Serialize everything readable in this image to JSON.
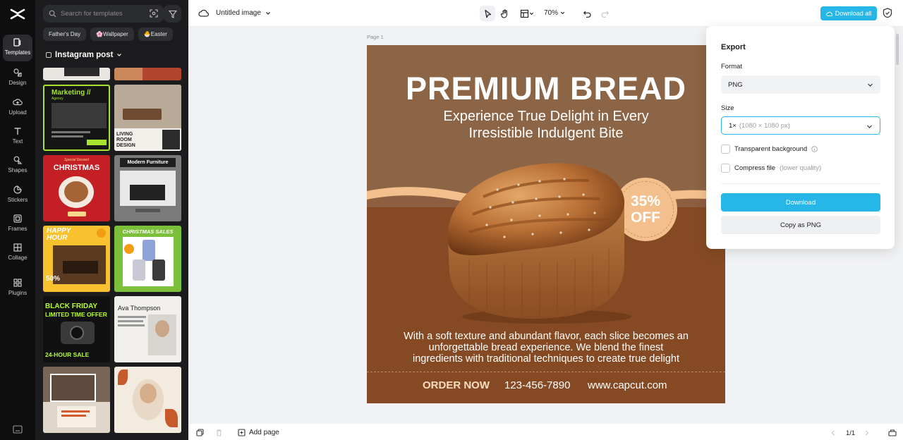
{
  "sidebar": {
    "items": [
      {
        "label": "Templates",
        "icon": "templates-icon"
      },
      {
        "label": "Design",
        "icon": "design-icon"
      },
      {
        "label": "Upload",
        "icon": "upload-icon"
      },
      {
        "label": "Text",
        "icon": "text-icon"
      },
      {
        "label": "Shapes",
        "icon": "shapes-icon"
      },
      {
        "label": "Stickers",
        "icon": "stickers-icon"
      },
      {
        "label": "Frames",
        "icon": "frames-icon"
      },
      {
        "label": "Collage",
        "icon": "collage-icon"
      },
      {
        "label": "Plugins",
        "icon": "plugins-icon"
      }
    ]
  },
  "panel": {
    "search_placeholder": "Search for templates",
    "chips": [
      "Father's Day",
      "🌸Wallpaper",
      "🐣Easter"
    ],
    "category": "Instagram post",
    "templates": [
      {
        "title": "Marketing //",
        "sub": "Agency"
      },
      {
        "title": "LIVING ROOM DESIGN",
        "sub": ""
      },
      {
        "title": "CHRISTMAS",
        "sub": "Special Dessert"
      },
      {
        "title": "Modern Furniture",
        "sub": ""
      },
      {
        "title": "HAPPY HOUR",
        "sub": "50%"
      },
      {
        "title": "CHRISTMAS SALES",
        "sub": ""
      },
      {
        "title": "BLACK FRIDAY",
        "sub": "LIMITED TIME OFFER"
      },
      {
        "title": "Ava Thompson",
        "sub": ""
      },
      {
        "title": "24-HOUR SALE",
        "sub": ""
      }
    ]
  },
  "topbar": {
    "title": "Untitled image",
    "zoom": "70%",
    "download_all": "Download all"
  },
  "canvas": {
    "page_label": "Page 1",
    "headline": "PREMIUM BREAD",
    "subline1": "Experience True Delight in Every",
    "subline2": "Irresistible Indulgent Bite",
    "badge_pct": "35%",
    "badge_off": "OFF",
    "body1": "With a soft texture and abundant flavor, each slice becomes an",
    "body2": "unforgettable bread experience. We blend the finest",
    "body3": "ingredients with traditional techniques to create true delight",
    "order": "ORDER NOW",
    "phone": "123-456-7890",
    "site": "www.capcut.com"
  },
  "export": {
    "title": "Export",
    "format_label": "Format",
    "format_value": "PNG",
    "size_label": "Size",
    "size_value": "1×",
    "size_dims": "(1080 × 1080 px)",
    "transparent": "Transparent background",
    "compress": "Compress file",
    "compress_note": "(lower quality)",
    "download": "Download",
    "copy": "Copy as PNG"
  },
  "bottombar": {
    "add_page": "Add page",
    "pager": "1/1"
  },
  "colors": {
    "accent": "#27b6e8",
    "rail": "#0e0e0f",
    "panel": "#1c1c1e",
    "art_brown": "#854a23",
    "art_cream": "#f3c08d"
  }
}
